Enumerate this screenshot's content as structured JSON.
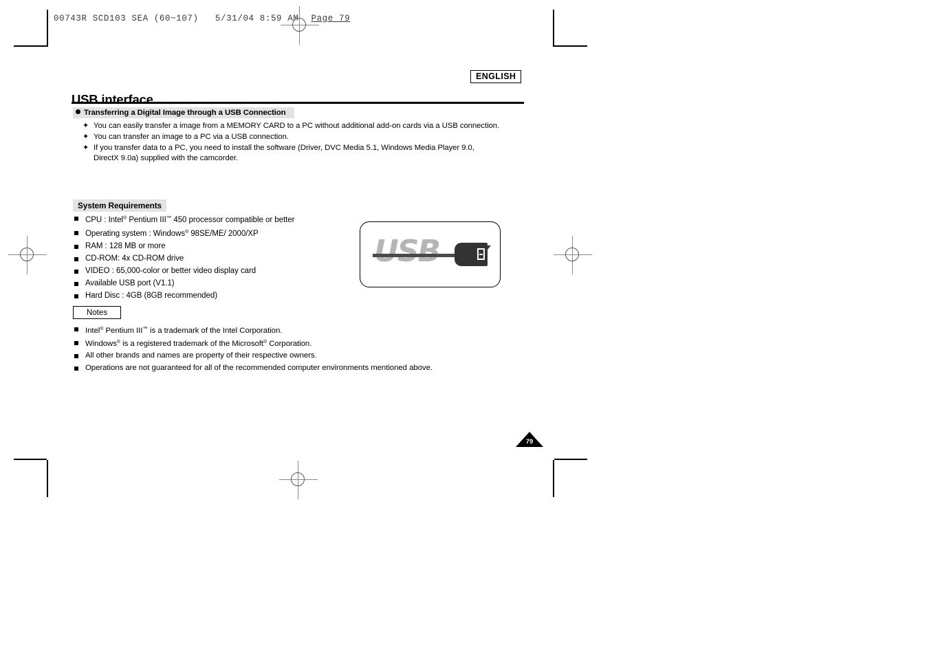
{
  "print_header": {
    "file_info": "00743R SCD103 SEA (60~107)   5/31/04 8:59 AM",
    "page_label": "Page 79"
  },
  "language_badge": "ENGLISH",
  "page_title": "USB interface",
  "section": {
    "heading": "Transferring a Digital Image through a USB Connection",
    "bullet_marker": "✦",
    "items": [
      "You can easily transfer a image from a MEMORY CARD to a PC without additional add-on cards via a USB connection.",
      "You can transfer an image to a PC via a USB connection.",
      "If you transfer data to a PC, you need to install the software (Driver, DVC Media 5.1, Windows Media Player 9.0,",
      "DirectX 9.0a) supplied with the camcorder."
    ]
  },
  "system_requirements": {
    "heading": "System Requirements",
    "items": [
      {
        "prefix": "CPU : Intel",
        "sup1": "®",
        "mid": " Pentium III",
        "sup2": "™",
        "suffix": " 450 processor compatible or better"
      },
      {
        "prefix": "Operating system : Windows",
        "sup1": "®",
        "mid": " 98SE/ME/ 2000/XP",
        "sup2": "",
        "suffix": ""
      },
      {
        "prefix": "RAM : 128 MB or more",
        "sup1": "",
        "mid": "",
        "sup2": "",
        "suffix": ""
      },
      {
        "prefix": "CD-ROM: 4x CD-ROM drive",
        "sup1": "",
        "mid": "",
        "sup2": "",
        "suffix": ""
      },
      {
        "prefix": "VIDEO : 65,000-color or better video display card",
        "sup1": "",
        "mid": "",
        "sup2": "",
        "suffix": ""
      },
      {
        "prefix": "Available USB port (V1.1)",
        "sup1": "",
        "mid": "",
        "sup2": "",
        "suffix": ""
      },
      {
        "prefix": "Hard Disc : 4GB (8GB recommended)",
        "sup1": "",
        "mid": "",
        "sup2": "",
        "suffix": ""
      }
    ]
  },
  "usb_logo": {
    "wordmark": "USB",
    "alt": "USB trademark logo"
  },
  "notes": {
    "label": "Notes",
    "items": [
      {
        "prefix": "Intel",
        "sup1": "®",
        "mid": " Pentium III",
        "sup2": "™",
        "suffix": " is a trademark of the Intel Corporation."
      },
      {
        "prefix": "Windows",
        "sup1": "®",
        "mid": " is a registered trademark of the Microsoft",
        "sup2": "®",
        "suffix": " Corporation."
      },
      {
        "prefix": "All other brands and names are property of their respective owners.",
        "sup1": "",
        "mid": "",
        "sup2": "",
        "suffix": ""
      },
      {
        "prefix": "Operations are not guaranteed for all of the recommended computer environments mentioned above.",
        "sup1": "",
        "mid": "",
        "sup2": "",
        "suffix": ""
      }
    ]
  },
  "page_number": "79"
}
